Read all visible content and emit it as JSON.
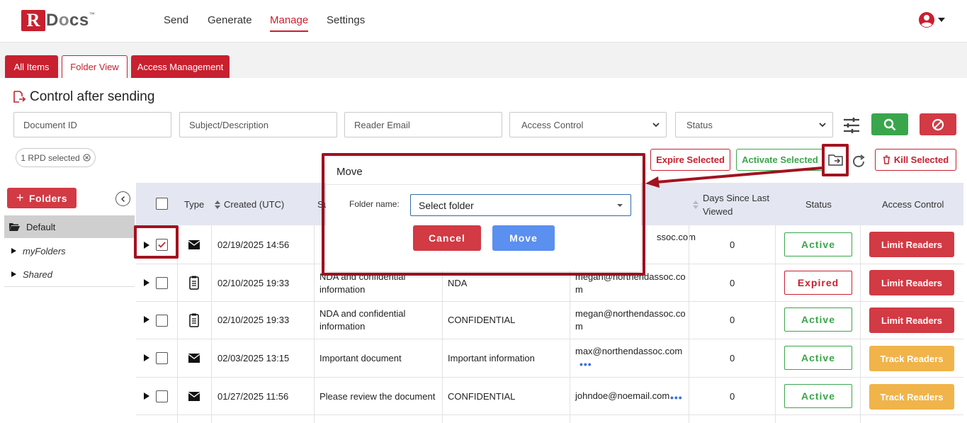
{
  "brand": {
    "logo_r": "R",
    "logo_rest": "D",
    "logo_o": "o",
    "logo_tail": "cs",
    "logo_tm": "™"
  },
  "nav": {
    "send": "Send",
    "generate": "Generate",
    "manage": "Manage",
    "settings": "Settings"
  },
  "tabs": {
    "all_items": "All Items",
    "folder_view": "Folder View",
    "access_management": "Access Management"
  },
  "page": {
    "title": "Control after sending"
  },
  "filters": {
    "document_id": "Document ID",
    "subject": "Subject/Description",
    "reader_email": "Reader Email",
    "access_control": "Access Control",
    "status": "Status"
  },
  "selection": {
    "chip": "1 RPD selected"
  },
  "actions": {
    "expire": "Expire Selected",
    "activate": "Activate Selected",
    "kill": "Kill Selected"
  },
  "sidebar": {
    "folders_button": "Folders",
    "items": [
      {
        "label": "Default"
      },
      {
        "label": "myFolders"
      },
      {
        "label": "Shared"
      }
    ]
  },
  "table": {
    "headers": {
      "type": "Type",
      "created": "Created (UTC)",
      "subject_partial": "Su",
      "days_line1": "Days Since Last",
      "days_line2": "Viewed",
      "status": "Status",
      "access": "Access Control"
    },
    "rows": [
      {
        "type": "email",
        "created": "02/19/2025 14:56",
        "subject_line1": "",
        "subject_line2": "",
        "desc": "",
        "email_line1": "ssoc.com",
        "email_line2": "",
        "days": "0",
        "status": "Active",
        "access": "Limit Readers",
        "checked": true
      },
      {
        "type": "doc",
        "created": "02/10/2025 19:33",
        "subject_line1": "NDA and confidential",
        "subject_line2": "information",
        "desc": "NDA",
        "email_line1": "megan@northendassoc.co",
        "email_line2": "m",
        "days": "0",
        "status": "Expired",
        "access": "Limit Readers"
      },
      {
        "type": "doc",
        "created": "02/10/2025 19:33",
        "subject_line1": "NDA and confidential",
        "subject_line2": "information",
        "desc": "CONFIDENTIAL",
        "email_line1": "megan@northendassoc.co",
        "email_line2": "m",
        "days": "0",
        "status": "Active",
        "access": "Limit Readers"
      },
      {
        "type": "email",
        "created": "02/03/2025 13:15",
        "subject_line1": "Important document",
        "subject_line2": "",
        "desc": "Important information",
        "email_line1": "max@northendassoc.com",
        "email_line2": "•••",
        "days": "0",
        "status": "Active",
        "access": "Track Readers"
      },
      {
        "type": "email",
        "created": "01/27/2025 11:56",
        "subject_line1": "Please review the document",
        "subject_line2": "",
        "desc": "CONFIDENTIAL",
        "email_line1": "johndoe@noemail.com",
        "email_line2": "•••",
        "days": "0",
        "status": "Active",
        "access": "Track Readers"
      }
    ]
  },
  "modal": {
    "title": "Move",
    "folder_label": "Folder name:",
    "folder_value": "Select folder",
    "cancel": "Cancel",
    "move": "Move"
  },
  "colors": {
    "brand_red": "#c8202f",
    "green": "#3aa64c",
    "blue_button": "#5b8ff0",
    "track_orange": "#f0b44a",
    "highlight": "#a3121f"
  }
}
